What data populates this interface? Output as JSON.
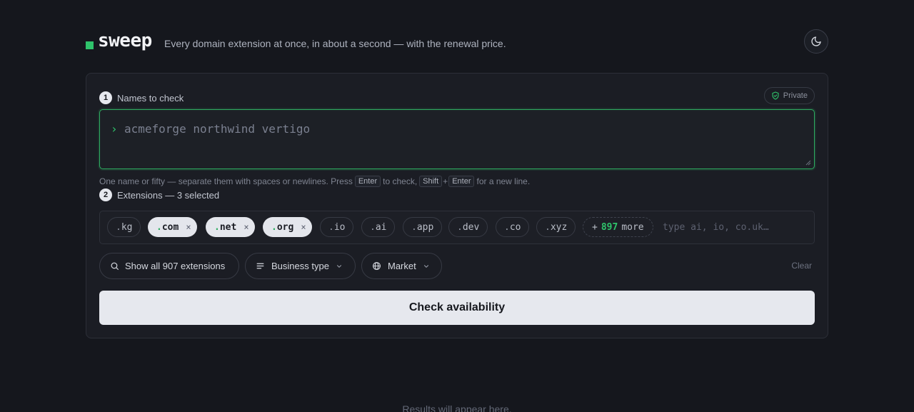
{
  "header": {
    "logo_text": "sweep",
    "tagline": "Every domain extension at once, in about a second — with the renewal price.",
    "theme_toggle_icon": "moon-icon"
  },
  "names_section": {
    "step_number": "1",
    "label": "Names to check",
    "private_badge": "Private",
    "prompt_symbol": "›",
    "input_value": "acmeforge northwind vertigo",
    "hint": {
      "part1": "One name or fifty — separate them with spaces or newlines. Press",
      "key_enter": "Enter",
      "part2": "to check,",
      "key_shift": "Shift",
      "plus": "+",
      "key_enter2": "Enter",
      "part3": "for a new line."
    }
  },
  "extensions_section": {
    "step_number": "2",
    "label": "Extensions — 3 selected",
    "chips": [
      {
        "dot": ".",
        "name": "kg",
        "selected": false
      },
      {
        "dot": ".",
        "name": "com",
        "selected": true
      },
      {
        "dot": ".",
        "name": "net",
        "selected": true
      },
      {
        "dot": ".",
        "name": "org",
        "selected": true
      },
      {
        "dot": ".",
        "name": "io",
        "selected": false
      },
      {
        "dot": ".",
        "name": "ai",
        "selected": false
      },
      {
        "dot": ".",
        "name": "app",
        "selected": false
      },
      {
        "dot": ".",
        "name": "dev",
        "selected": false
      },
      {
        "dot": ".",
        "name": "co",
        "selected": false
      },
      {
        "dot": ".",
        "name": "xyz",
        "selected": false
      }
    ],
    "remove_symbol": "×",
    "more": {
      "plus": "+",
      "count": "897",
      "label": "more"
    },
    "input_placeholder": "type ai, io, co.uk…"
  },
  "filters": {
    "show_all": "Show all 907 extensions",
    "business_type": "Business type",
    "market": "Market",
    "clear": "Clear"
  },
  "check_button": "Check availability",
  "results_placeholder": "Results will appear here.",
  "colors": {
    "background": "#15171d",
    "card": "#1b1d24",
    "accent": "#2fc36b"
  }
}
